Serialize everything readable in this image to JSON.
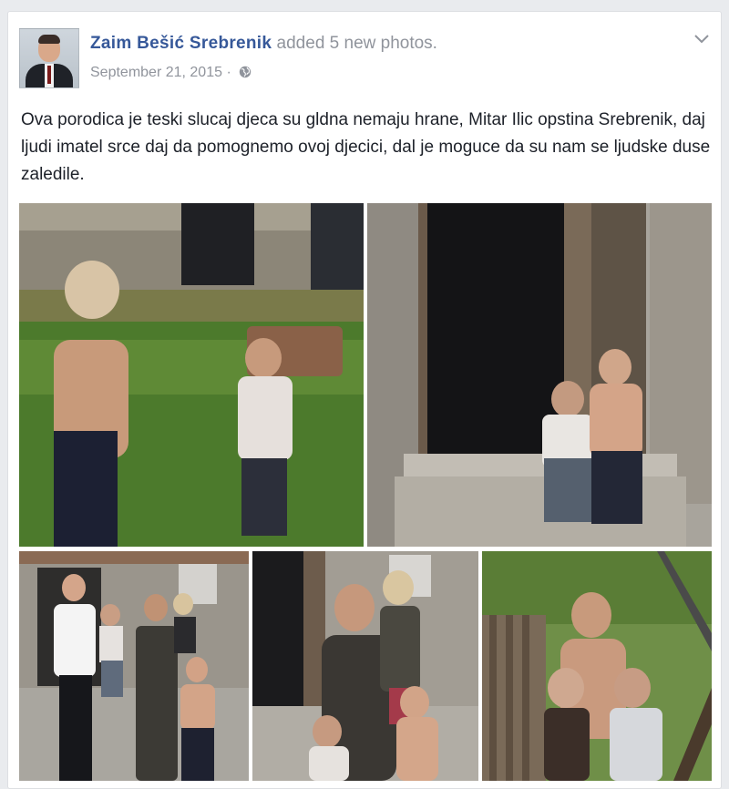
{
  "post": {
    "author": "Zaim Bešić Srebrenik",
    "action": "added 5 new photos.",
    "date": "September 21, 2015",
    "date_separator": "·",
    "privacy_icon": "globe-icon",
    "menu_icon": "chevron-down-icon",
    "text": "Ova porodica je teski slucaj djeca su gldna nemaju hrane, Mitar Ilic opstina Srebrenik, daj ljudi imatel srce daj da pomognemo ovoj djecici, dal je moguce da su nam se ljudske duse zaledile."
  },
  "colors": {
    "link": "#365899",
    "meta": "#90949c",
    "text": "#1d2129",
    "background": "#e9ebee"
  }
}
